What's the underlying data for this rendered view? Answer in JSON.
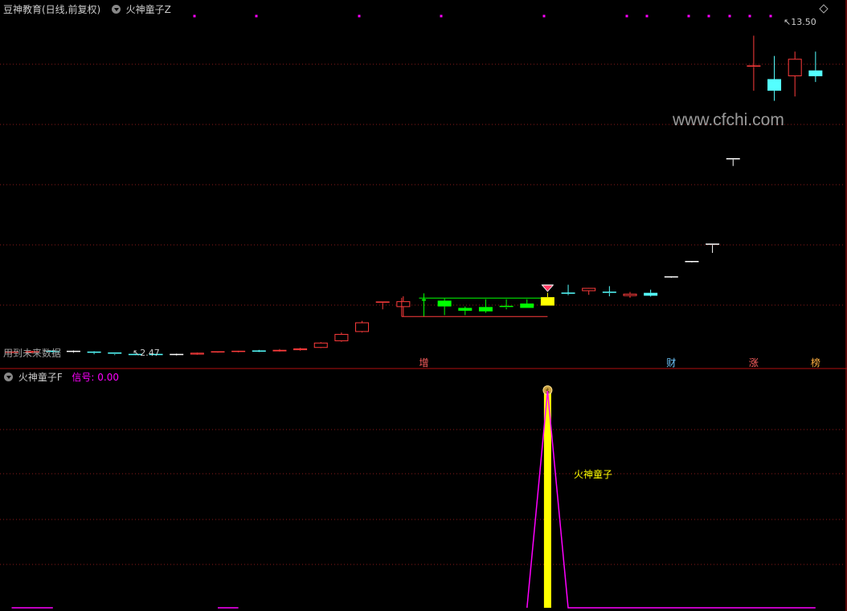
{
  "main_panel": {
    "title": "豆神教育(日线,前复权)",
    "indicator": "火神童子Z",
    "future_note": "用到未来数据",
    "high_label": "13.50",
    "low_label": "2.47",
    "watermark": "www.cfchi.com",
    "markers": [
      {
        "index": 20,
        "text": "增",
        "color": "#ff6060"
      },
      {
        "index": 32,
        "text": "财",
        "color": "#6ec8ff"
      },
      {
        "index": 36,
        "text": "涨",
        "color": "#ff6060"
      },
      {
        "index": 39,
        "text": "榜",
        "color": "#ffb040"
      }
    ]
  },
  "sub_panel": {
    "indicator": "火神童子F",
    "signal_label": "信号:",
    "signal_value": "0.00",
    "signal_text": "火神童子",
    "colors": {
      "bar": "#ffff00",
      "line": "#ff00ff",
      "label": "#ffff00"
    }
  },
  "colors": {
    "up": "#ff3c3c",
    "down_cyan": "#54ffff",
    "box_green": "#00ff00",
    "signal_yellow": "#ffff00",
    "grid": "#8b1a1a",
    "divider": "#b01010"
  },
  "chart_data": [
    {
      "type": "candlestick",
      "title": "豆神教育(日线,前复权)",
      "ylim": [
        2.2,
        13.9
      ],
      "candles": [
        {
          "o": 2.55,
          "h": 2.6,
          "l": 2.5,
          "c": 2.57,
          "color": "red"
        },
        {
          "o": 2.57,
          "h": 2.62,
          "l": 2.52,
          "c": 2.58,
          "color": "red"
        },
        {
          "o": 2.59,
          "h": 2.62,
          "l": 2.55,
          "c": 2.6,
          "color": "cyan"
        },
        {
          "o": 2.6,
          "h": 2.63,
          "l": 2.55,
          "c": 2.58,
          "color": "white"
        },
        {
          "o": 2.57,
          "h": 2.6,
          "l": 2.5,
          "c": 2.55,
          "color": "cyan"
        },
        {
          "o": 2.54,
          "h": 2.56,
          "l": 2.47,
          "c": 2.5,
          "color": "cyan"
        },
        {
          "o": 2.49,
          "h": 2.52,
          "l": 2.46,
          "c": 2.48,
          "color": "cyan"
        },
        {
          "o": 2.48,
          "h": 2.5,
          "l": 2.45,
          "c": 2.49,
          "color": "cyan"
        },
        {
          "o": 2.49,
          "h": 2.52,
          "l": 2.45,
          "c": 2.47,
          "color": "white"
        },
        {
          "o": 2.49,
          "h": 2.56,
          "l": 2.48,
          "c": 2.55,
          "color": "red"
        },
        {
          "o": 2.54,
          "h": 2.6,
          "l": 2.53,
          "c": 2.58,
          "color": "red"
        },
        {
          "o": 2.58,
          "h": 2.62,
          "l": 2.56,
          "c": 2.6,
          "color": "red"
        },
        {
          "o": 2.6,
          "h": 2.65,
          "l": 2.57,
          "c": 2.61,
          "color": "cyan"
        },
        {
          "o": 2.6,
          "h": 2.68,
          "l": 2.59,
          "c": 2.65,
          "color": "red"
        },
        {
          "o": 2.64,
          "h": 2.72,
          "l": 2.62,
          "c": 2.7,
          "color": "red"
        },
        {
          "o": 2.72,
          "h": 2.92,
          "l": 2.71,
          "c": 2.9,
          "color": "red"
        },
        {
          "o": 2.95,
          "h": 3.25,
          "l": 2.93,
          "c": 3.2,
          "color": "red"
        },
        {
          "o": 3.27,
          "h": 3.65,
          "l": 3.25,
          "c": 3.6,
          "color": "red"
        },
        {
          "o": 4.3,
          "h": 4.32,
          "l": 4.05,
          "c": 4.3,
          "color": "red"
        },
        {
          "o": 4.13,
          "h": 4.5,
          "l": 3.8,
          "c": 4.33,
          "color": "red"
        },
        {
          "o": 4.4,
          "h": 4.6,
          "l": 3.8,
          "c": 4.35,
          "color": "green_hollow"
        },
        {
          "o": 4.35,
          "h": 4.42,
          "l": 3.85,
          "c": 4.15,
          "color": "green"
        },
        {
          "o": 4.1,
          "h": 4.15,
          "l": 3.85,
          "c": 4.0,
          "color": "green"
        },
        {
          "o": 4.13,
          "h": 4.4,
          "l": 3.93,
          "c": 3.98,
          "color": "green"
        },
        {
          "o": 4.15,
          "h": 4.4,
          "l": 4.05,
          "c": 4.11,
          "color": "green"
        },
        {
          "o": 4.25,
          "h": 4.4,
          "l": 4.1,
          "c": 4.1,
          "color": "green"
        },
        {
          "o": 4.47,
          "h": 4.62,
          "l": 4.18,
          "c": 4.18,
          "color": "yellow"
        },
        {
          "o": 4.61,
          "h": 4.9,
          "l": 4.54,
          "c": 4.58,
          "color": "cyan"
        },
        {
          "o": 4.68,
          "h": 4.73,
          "l": 4.55,
          "c": 4.79,
          "color": "red"
        },
        {
          "o": 4.64,
          "h": 4.85,
          "l": 4.5,
          "c": 4.61,
          "color": "cyan"
        },
        {
          "o": 4.51,
          "h": 4.65,
          "l": 4.45,
          "c": 4.59,
          "color": "red"
        },
        {
          "o": 4.62,
          "h": 4.73,
          "l": 4.49,
          "c": 4.52,
          "color": "cyan"
        },
        {
          "o": 5.17,
          "h": 5.17,
          "l": 5.17,
          "c": 5.17,
          "color": "white"
        },
        {
          "o": 5.7,
          "h": 5.7,
          "l": 5.7,
          "c": 5.7,
          "color": "white"
        },
        {
          "o": 6.3,
          "h": 6.3,
          "l": 6.0,
          "c": 6.3,
          "color": "white"
        },
        {
          "o": 9.25,
          "h": 9.25,
          "l": 9.0,
          "c": 9.25,
          "color": "white"
        },
        {
          "o": 12.45,
          "h": 13.5,
          "l": 11.6,
          "c": 12.45,
          "color": "red"
        },
        {
          "o": 12.0,
          "h": 12.8,
          "l": 11.25,
          "c": 11.6,
          "color": "cyan"
        },
        {
          "o": 12.1,
          "h": 12.95,
          "l": 11.4,
          "c": 12.7,
          "color": "red"
        },
        {
          "o": 12.3,
          "h": 12.95,
          "l": 11.9,
          "c": 12.1,
          "color": "cyan"
        }
      ]
    },
    {
      "type": "line",
      "title": "火神童子F",
      "ylim": [
        0,
        100
      ],
      "signal_index": 26,
      "series": [
        {
          "values": [
            0,
            0,
            0,
            0,
            0,
            0,
            0,
            0,
            0,
            0,
            0,
            0,
            0,
            0,
            0,
            0,
            0,
            0,
            0,
            0,
            0,
            0,
            0,
            0,
            0,
            0,
            100,
            0,
            0,
            0,
            0,
            0,
            0,
            0,
            0,
            0,
            0,
            0,
            0,
            0
          ]
        }
      ],
      "visible_segments": [
        [
          0,
          2
        ],
        [
          10,
          11
        ],
        [
          25,
          39
        ]
      ]
    }
  ]
}
